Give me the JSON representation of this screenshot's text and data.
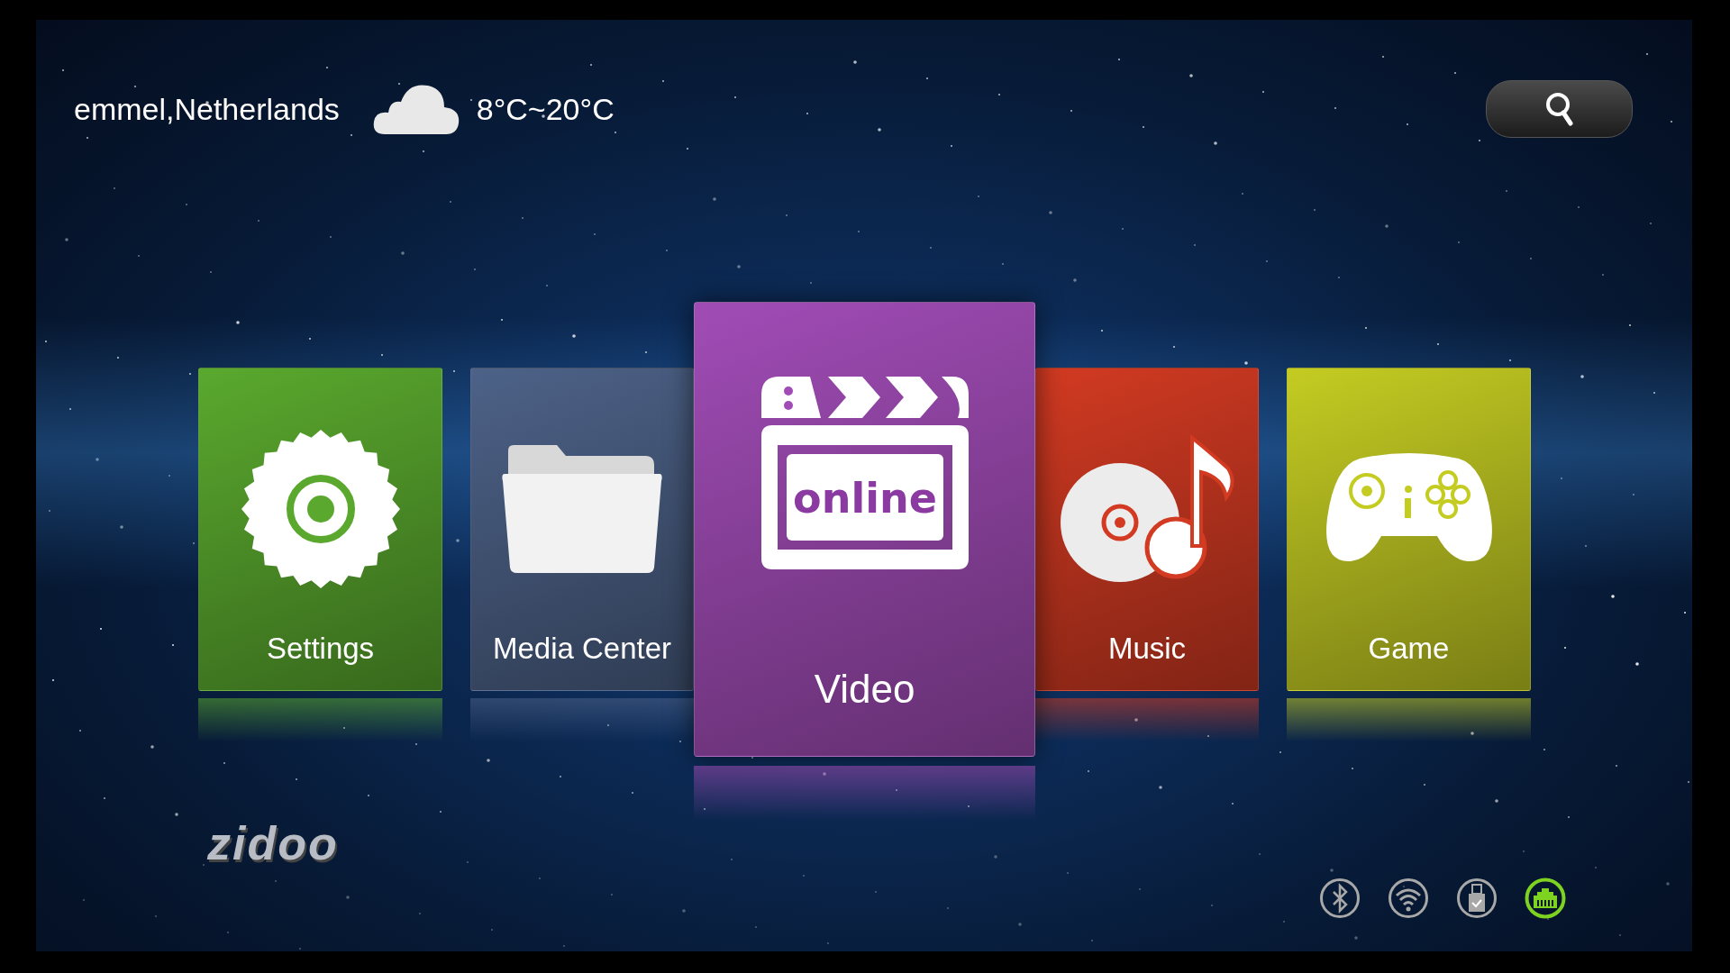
{
  "weather": {
    "location": "emmel,Netherlands",
    "kind": "cloudy",
    "temperature": "8°C~20°C"
  },
  "tiles": [
    {
      "kind": "settings",
      "label": "Settings",
      "color": "#5aa92e",
      "selected": false
    },
    {
      "kind": "media",
      "label": "Media Center",
      "color": "#4d6288",
      "selected": false
    },
    {
      "kind": "video",
      "label": "Video",
      "icon_text": "online",
      "color": "#a14cb6",
      "selected": true
    },
    {
      "kind": "music",
      "label": "Music",
      "color": "#d23a22",
      "selected": false
    },
    {
      "kind": "game",
      "label": "Game",
      "color": "#c4cc22",
      "selected": false
    }
  ],
  "logo": "zidoo",
  "status_icons": [
    {
      "kind": "bluetooth",
      "active": false
    },
    {
      "kind": "wifi",
      "active": false
    },
    {
      "kind": "usb",
      "active": false
    },
    {
      "kind": "ethernet",
      "active": true
    }
  ]
}
